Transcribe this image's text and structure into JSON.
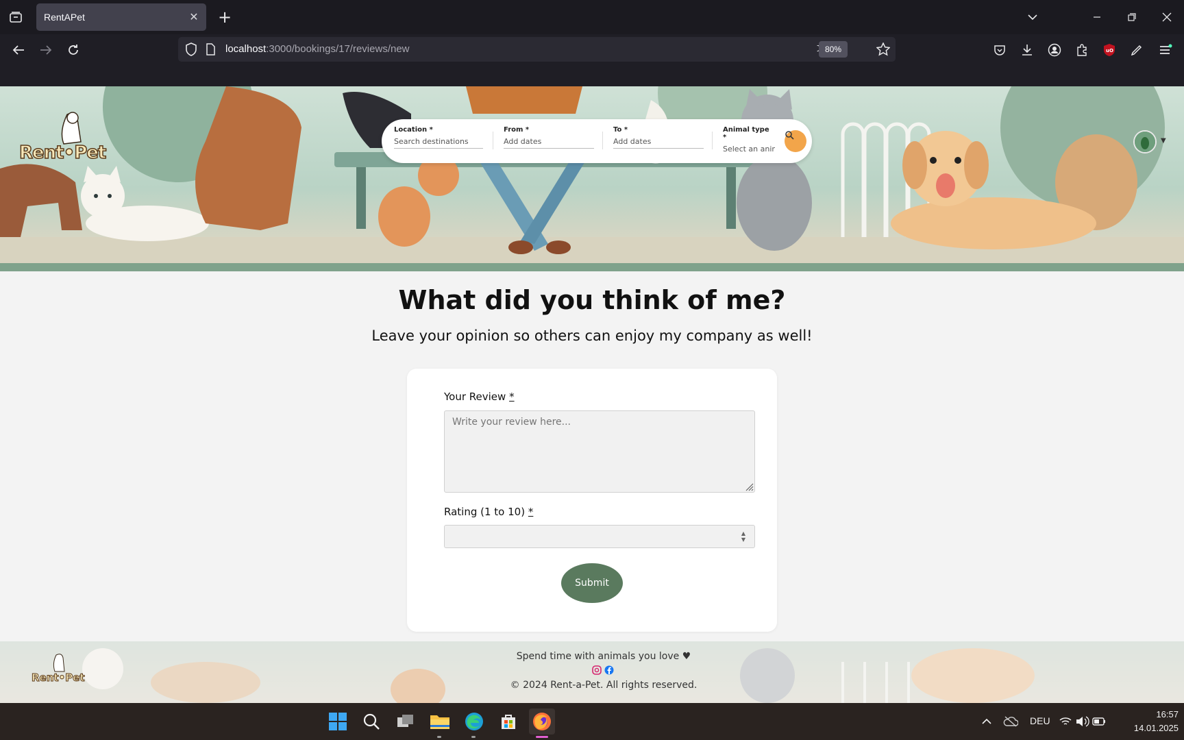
{
  "browser": {
    "tab_title": "RentAPet",
    "url_host": "localhost",
    "url_path": ":3000/bookings/17/reviews/new",
    "zoom": "80%"
  },
  "search": {
    "location_label": "Location",
    "location_placeholder": "Search destinations",
    "from_label": "From",
    "from_placeholder": "Add dates",
    "to_label": "To",
    "to_placeholder": "Add dates",
    "animal_label": "Animal type",
    "animal_placeholder": "Select an animal",
    "required_mark": "*"
  },
  "brand": {
    "logo_text": "Rent•Pet"
  },
  "main": {
    "title": "What did you think of me?",
    "subtitle": "Leave your opinion so others can enjoy my company as well!"
  },
  "form": {
    "review_label": "Your Review",
    "review_placeholder": "Write your review here...",
    "rating_label": "Rating (1 to 10)",
    "rating_value": "",
    "required_mark": "*",
    "submit_label": "Submit"
  },
  "footer": {
    "tagline": "Spend time with animals you love ♥",
    "copyright": "© 2024 Rent-a-Pet. All rights reserved."
  },
  "taskbar": {
    "language": "DEU",
    "time": "16:57",
    "date": "14.01.2025"
  },
  "colors": {
    "accent_green": "#5a7a5e",
    "search_orange": "#f2a54a",
    "chrome_bg": "#1f1e25"
  }
}
